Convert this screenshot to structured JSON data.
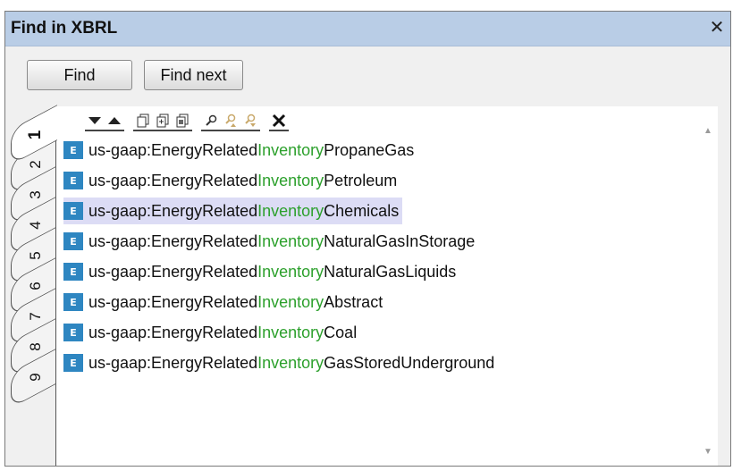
{
  "window": {
    "title": "Find in XBRL",
    "close_glyph": "✕"
  },
  "buttons": {
    "find": "Find",
    "find_next": "Find next"
  },
  "tabs": [
    "1",
    "2",
    "3",
    "4",
    "5",
    "6",
    "7",
    "8",
    "9"
  ],
  "active_tab": "1",
  "toolbar": [
    {
      "icon": "move-down-icon"
    },
    {
      "icon": "move-up-icon"
    },
    {
      "icon": "copy-icon"
    },
    {
      "icon": "copy-all-icon"
    },
    {
      "icon": "copy-path-icon"
    },
    {
      "icon": "find-icon"
    },
    {
      "icon": "find-previous-icon"
    },
    {
      "icon": "find-next-icon"
    },
    {
      "icon": "delete-icon"
    }
  ],
  "results": [
    {
      "prefix": "us-gaap:EnergyRelated",
      "match": "Inventory",
      "suffix": "PropaneGas"
    },
    {
      "prefix": "us-gaap:EnergyRelated",
      "match": "Inventory",
      "suffix": "Petroleum"
    },
    {
      "prefix": "us-gaap:EnergyRelated",
      "match": "Inventory",
      "suffix": "Chemicals"
    },
    {
      "prefix": "us-gaap:EnergyRelated",
      "match": "Inventory",
      "suffix": "NaturalGasInStorage"
    },
    {
      "prefix": "us-gaap:EnergyRelated",
      "match": "Inventory",
      "suffix": "NaturalGasLiquids"
    },
    {
      "prefix": "us-gaap:EnergyRelated",
      "match": "Inventory",
      "suffix": "Abstract"
    },
    {
      "prefix": "us-gaap:EnergyRelated",
      "match": "Inventory",
      "suffix": "Coal"
    },
    {
      "prefix": "us-gaap:EnergyRelated",
      "match": "Inventory",
      "suffix": "GasStoredUnderground"
    }
  ],
  "selected_index": 2,
  "element_badge": "E",
  "colors": {
    "match": "#2ca02c",
    "title_bar": "#b9cde6",
    "selection": "#dcdcf5",
    "element_icon": "#2e86c1"
  }
}
